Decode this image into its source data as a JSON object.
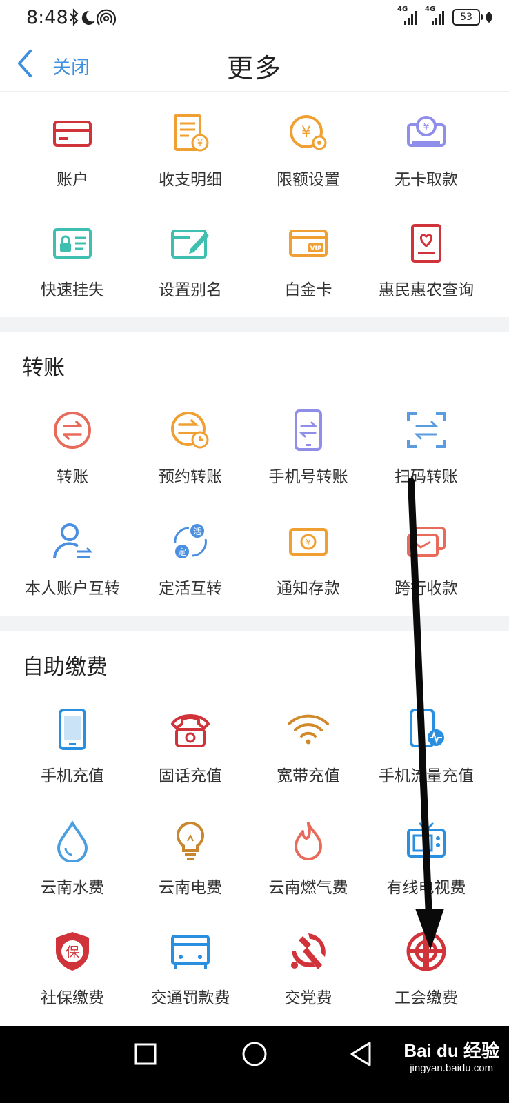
{
  "status_bar": {
    "time": "8:48",
    "signal1": "4G",
    "signal2": "4G",
    "battery": "53"
  },
  "header": {
    "back_label": "关闭",
    "title": "更多"
  },
  "account_section": {
    "items": [
      {
        "label": "账户",
        "icon": "card-icon"
      },
      {
        "label": "收支明细",
        "icon": "statement-icon"
      },
      {
        "label": "限额设置",
        "icon": "limit-settings-icon"
      },
      {
        "label": "无卡取款",
        "icon": "cardless-withdrawal-icon"
      },
      {
        "label": "快速挂失",
        "icon": "report-loss-icon"
      },
      {
        "label": "设置别名",
        "icon": "alias-edit-icon"
      },
      {
        "label": "白金卡",
        "icon": "vip-card-icon"
      },
      {
        "label": "惠民惠农查询",
        "icon": "benefit-query-icon"
      }
    ]
  },
  "transfer_section": {
    "title": "转账",
    "items": [
      {
        "label": "转账",
        "icon": "transfer-icon"
      },
      {
        "label": "预约转账",
        "icon": "scheduled-transfer-icon"
      },
      {
        "label": "手机号转账",
        "icon": "phone-transfer-icon"
      },
      {
        "label": "扫码转账",
        "icon": "scan-transfer-icon"
      },
      {
        "label": "本人账户互转",
        "icon": "own-account-transfer-icon"
      },
      {
        "label": "定活互转",
        "icon": "fixed-current-transfer-icon"
      },
      {
        "label": "通知存款",
        "icon": "notice-deposit-icon"
      },
      {
        "label": "跨行收款",
        "icon": "interbank-collection-icon"
      }
    ]
  },
  "payment_section": {
    "title": "自助缴费",
    "items": [
      {
        "label": "手机充值",
        "icon": "mobile-recharge-icon"
      },
      {
        "label": "固话充值",
        "icon": "telephone-icon"
      },
      {
        "label": "宽带充值",
        "icon": "wifi-icon"
      },
      {
        "label": "手机流量充值",
        "icon": "mobile-data-icon"
      },
      {
        "label": "云南水费",
        "icon": "water-drop-icon"
      },
      {
        "label": "云南电费",
        "icon": "light-bulb-icon"
      },
      {
        "label": "云南燃气费",
        "icon": "flame-icon"
      },
      {
        "label": "有线电视费",
        "icon": "tv-icon"
      },
      {
        "label": "社保缴费",
        "icon": "social-security-shield-icon"
      },
      {
        "label": "交通罚款费",
        "icon": "traffic-fine-icon"
      },
      {
        "label": "交党费",
        "icon": "party-emblem-icon"
      },
      {
        "label": "工会缴费",
        "icon": "trade-union-icon"
      }
    ],
    "shield_char": "保"
  },
  "watermark": {
    "line1": "Bai du 经验",
    "line2": "jingyan.baidu.com"
  },
  "colors": {
    "accent": "#3d8fe0",
    "red": "#d0343a",
    "orange": "#f0a032",
    "teal": "#3fbfb0",
    "purple": "#8f8ee8",
    "arrow": "#0a0a0a"
  }
}
